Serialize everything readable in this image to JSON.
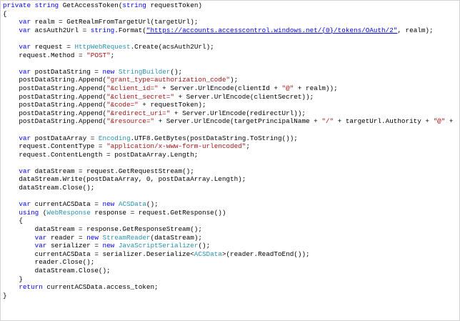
{
  "colors": {
    "background": "#ffffff",
    "text": "#000000",
    "keyword": "#0000ff",
    "string": "#a31515",
    "type": "#2b91af",
    "link": "#0000ee",
    "border": "#d4d4d4"
  },
  "code": {
    "lines": [
      [
        {
          "t": "kw",
          "v": "private"
        },
        {
          "t": "p",
          "v": " "
        },
        {
          "t": "kw",
          "v": "string"
        },
        {
          "t": "p",
          "v": " GetAccessToken("
        },
        {
          "t": "kw",
          "v": "string"
        },
        {
          "t": "p",
          "v": " requestToken)"
        }
      ],
      [
        {
          "t": "p",
          "v": "{"
        }
      ],
      [
        {
          "t": "p",
          "v": "    "
        },
        {
          "t": "kw",
          "v": "var"
        },
        {
          "t": "p",
          "v": " realm = GetRealmFromTargetUrl(targetUrl);"
        }
      ],
      [
        {
          "t": "p",
          "v": "    "
        },
        {
          "t": "kw",
          "v": "var"
        },
        {
          "t": "p",
          "v": " acsAuth2Url = "
        },
        {
          "t": "kw",
          "v": "string"
        },
        {
          "t": "p",
          "v": ".Format("
        },
        {
          "t": "url",
          "v": "\"https://accounts.accesscontrol.windows.net/{0}/tokens/OAuth/2\""
        },
        {
          "t": "p",
          "v": ", realm);"
        }
      ],
      [],
      [
        {
          "t": "p",
          "v": "    "
        },
        {
          "t": "kw",
          "v": "var"
        },
        {
          "t": "p",
          "v": " request = "
        },
        {
          "t": "typ",
          "v": "HttpWebRequest"
        },
        {
          "t": "p",
          "v": ".Create(acsAuth2Url);"
        }
      ],
      [
        {
          "t": "p",
          "v": "    request.Method = "
        },
        {
          "t": "str",
          "v": "\"POST\""
        },
        {
          "t": "p",
          "v": ";"
        }
      ],
      [],
      [
        {
          "t": "p",
          "v": "    "
        },
        {
          "t": "kw",
          "v": "var"
        },
        {
          "t": "p",
          "v": " postDataString = "
        },
        {
          "t": "kw",
          "v": "new"
        },
        {
          "t": "p",
          "v": " "
        },
        {
          "t": "typ",
          "v": "StringBuilder"
        },
        {
          "t": "p",
          "v": "();"
        }
      ],
      [
        {
          "t": "p",
          "v": "    postDataString.Append("
        },
        {
          "t": "str",
          "v": "\"grant_type=authorization_code\""
        },
        {
          "t": "p",
          "v": ");"
        }
      ],
      [
        {
          "t": "p",
          "v": "    postDataString.Append("
        },
        {
          "t": "str",
          "v": "\"&client_id=\""
        },
        {
          "t": "p",
          "v": " + Server.UrlEncode(clientId + "
        },
        {
          "t": "str",
          "v": "\"@\""
        },
        {
          "t": "p",
          "v": " + realm));"
        }
      ],
      [
        {
          "t": "p",
          "v": "    postDataString.Append("
        },
        {
          "t": "str",
          "v": "\"&client_secret=\""
        },
        {
          "t": "p",
          "v": " + Server.UrlEncode(clientSecret));"
        }
      ],
      [
        {
          "t": "p",
          "v": "    postDataString.Append("
        },
        {
          "t": "str",
          "v": "\"&code=\""
        },
        {
          "t": "p",
          "v": " + requestToken);"
        }
      ],
      [
        {
          "t": "p",
          "v": "    postDataString.Append("
        },
        {
          "t": "str",
          "v": "\"&redirect_uri=\""
        },
        {
          "t": "p",
          "v": " + Server.UrlEncode(redirectUrl));"
        }
      ],
      [
        {
          "t": "p",
          "v": "    postDataString.Append("
        },
        {
          "t": "str",
          "v": "\"&resource=\""
        },
        {
          "t": "p",
          "v": " + Server.UrlEncode(targetPrincipalName + "
        },
        {
          "t": "str",
          "v": "\"/\""
        },
        {
          "t": "p",
          "v": " + targetUrl.Authority + "
        },
        {
          "t": "str",
          "v": "\"@\""
        },
        {
          "t": "p",
          "v": " + realm));"
        }
      ],
      [],
      [
        {
          "t": "p",
          "v": "    "
        },
        {
          "t": "kw",
          "v": "var"
        },
        {
          "t": "p",
          "v": " postDataArray = "
        },
        {
          "t": "typ",
          "v": "Encoding"
        },
        {
          "t": "p",
          "v": ".UTF8.GetBytes(postDataString.ToString());"
        }
      ],
      [
        {
          "t": "p",
          "v": "    request.ContentType = "
        },
        {
          "t": "str",
          "v": "\"application/x-www-form-urlencoded\""
        },
        {
          "t": "p",
          "v": ";"
        }
      ],
      [
        {
          "t": "p",
          "v": "    request.ContentLength = postDataArray.Length;"
        }
      ],
      [],
      [
        {
          "t": "p",
          "v": "    "
        },
        {
          "t": "kw",
          "v": "var"
        },
        {
          "t": "p",
          "v": " dataStream = request.GetRequestStream();"
        }
      ],
      [
        {
          "t": "p",
          "v": "    dataStream.Write(postDataArray, 0, postDataArray.Length);"
        }
      ],
      [
        {
          "t": "p",
          "v": "    dataStream.Close();"
        }
      ],
      [],
      [
        {
          "t": "p",
          "v": "    "
        },
        {
          "t": "kw",
          "v": "var"
        },
        {
          "t": "p",
          "v": " currentACSData = "
        },
        {
          "t": "kw",
          "v": "new"
        },
        {
          "t": "p",
          "v": " "
        },
        {
          "t": "typ",
          "v": "ACSData"
        },
        {
          "t": "p",
          "v": "();"
        }
      ],
      [
        {
          "t": "p",
          "v": "    "
        },
        {
          "t": "kw",
          "v": "using"
        },
        {
          "t": "p",
          "v": " ("
        },
        {
          "t": "typ",
          "v": "WebResponse"
        },
        {
          "t": "p",
          "v": " response = request.GetResponse())"
        }
      ],
      [
        {
          "t": "p",
          "v": "    {"
        }
      ],
      [
        {
          "t": "p",
          "v": "        dataStream = response.GetResponseStream();"
        }
      ],
      [
        {
          "t": "p",
          "v": "        "
        },
        {
          "t": "kw",
          "v": "var"
        },
        {
          "t": "p",
          "v": " reader = "
        },
        {
          "t": "kw",
          "v": "new"
        },
        {
          "t": "p",
          "v": " "
        },
        {
          "t": "typ",
          "v": "StreamReader"
        },
        {
          "t": "p",
          "v": "(dataStream);"
        }
      ],
      [
        {
          "t": "p",
          "v": "        "
        },
        {
          "t": "kw",
          "v": "var"
        },
        {
          "t": "p",
          "v": " serializer = "
        },
        {
          "t": "kw",
          "v": "new"
        },
        {
          "t": "p",
          "v": " "
        },
        {
          "t": "typ",
          "v": "JavaScriptSerializer"
        },
        {
          "t": "p",
          "v": "();"
        }
      ],
      [
        {
          "t": "p",
          "v": "        currentACSData = serializer.Deserialize<"
        },
        {
          "t": "typ",
          "v": "ACSData"
        },
        {
          "t": "p",
          "v": ">(reader.ReadToEnd());"
        }
      ],
      [
        {
          "t": "p",
          "v": "        reader.Close();"
        }
      ],
      [
        {
          "t": "p",
          "v": "        dataStream.Close();"
        }
      ],
      [
        {
          "t": "p",
          "v": "    }"
        }
      ],
      [
        {
          "t": "p",
          "v": "    "
        },
        {
          "t": "kw",
          "v": "return"
        },
        {
          "t": "p",
          "v": " currentACSData.access_token;"
        }
      ],
      [
        {
          "t": "p",
          "v": "}"
        }
      ]
    ]
  }
}
